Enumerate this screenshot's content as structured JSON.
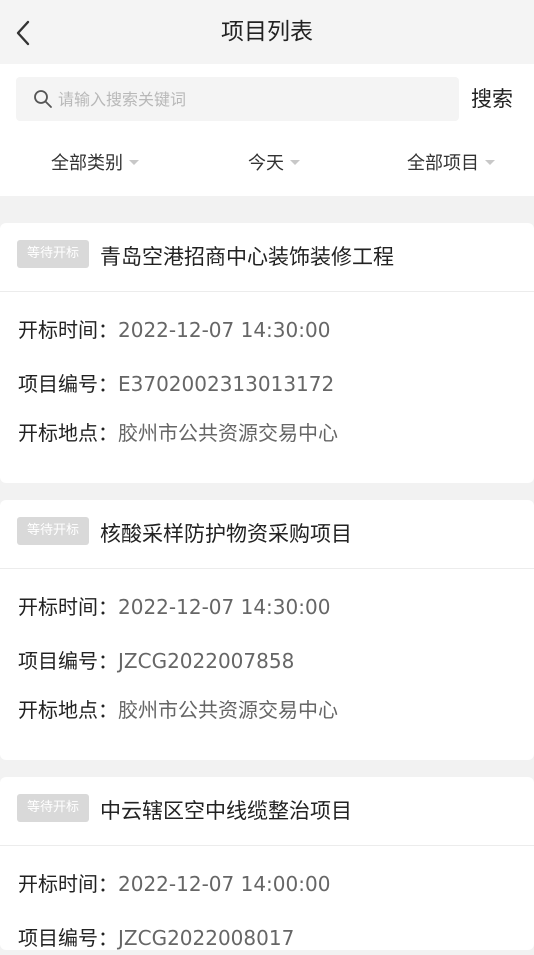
{
  "header": {
    "title": "项目列表"
  },
  "search": {
    "placeholder": "请输入搜索关键词",
    "value": "",
    "button_label": "搜索"
  },
  "filters": {
    "category": "全部类别",
    "date": "今天",
    "project": "全部项目"
  },
  "labels": {
    "time": "开标时间：",
    "number": "项目编号：",
    "location": "开标地点："
  },
  "projects": [
    {
      "status": "等待开标",
      "title": "青岛空港招商中心装饰装修工程",
      "time": "2022-12-07 14:30:00",
      "number": "E3702002313013172",
      "location": "胶州市公共资源交易中心"
    },
    {
      "status": "等待开标",
      "title": "核酸采样防护物资采购项目",
      "time": "2022-12-07 14:30:00",
      "number": "JZCG2022007858",
      "location": "胶州市公共资源交易中心"
    },
    {
      "status": "等待开标",
      "title": "中云辖区空中线缆整治项目",
      "time": "2022-12-07 14:00:00",
      "number": "JZCG2022008017"
    }
  ]
}
